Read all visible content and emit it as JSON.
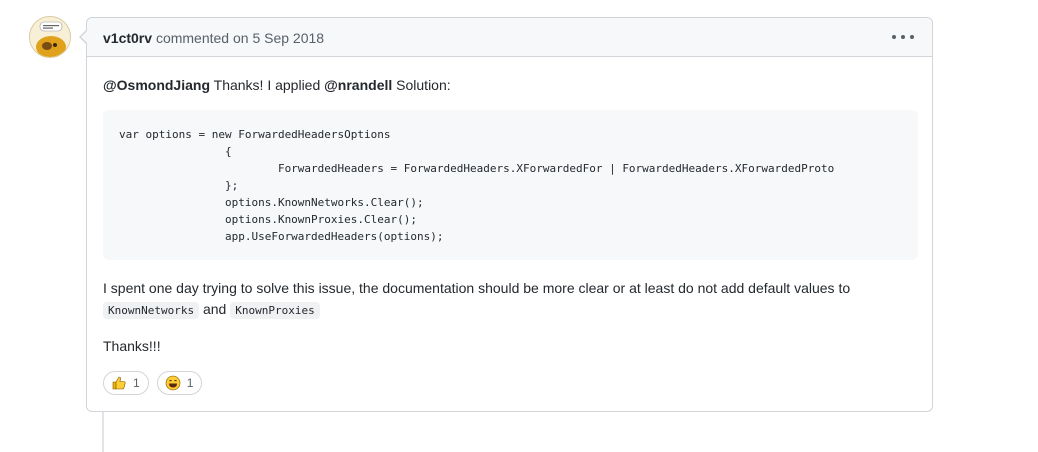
{
  "comment": {
    "author": "v1ct0rv",
    "action": "commented on",
    "date": "5 Sep 2018",
    "body": {
      "mention1": "@OsmondJiang",
      "text1": " Thanks! I applied ",
      "mention2": "@nrandell",
      "text2": " Solution:",
      "code": "var options = new ForwardedHeadersOptions\n                {\n                        ForwardedHeaders = ForwardedHeaders.XForwardedFor | ForwardedHeaders.XForwardedProto\n                };\n                options.KnownNetworks.Clear();\n                options.KnownProxies.Clear();\n                app.UseForwardedHeaders(options);",
      "text3": "I spent one day trying to solve this issue, the documentation should be more clear or at least do not add default values to ",
      "code1": "KnownNetworks",
      "text4": " and ",
      "code2": "KnownProxies",
      "text5": "Thanks!!!"
    },
    "reactions": [
      {
        "icon": "thumbs-up-icon",
        "count": "1"
      },
      {
        "icon": "laugh-icon",
        "count": "1"
      }
    ]
  },
  "colors": {
    "border": "#d1d5da",
    "header_bg": "#f6f8fa",
    "text": "#24292e",
    "muted": "#586069"
  }
}
